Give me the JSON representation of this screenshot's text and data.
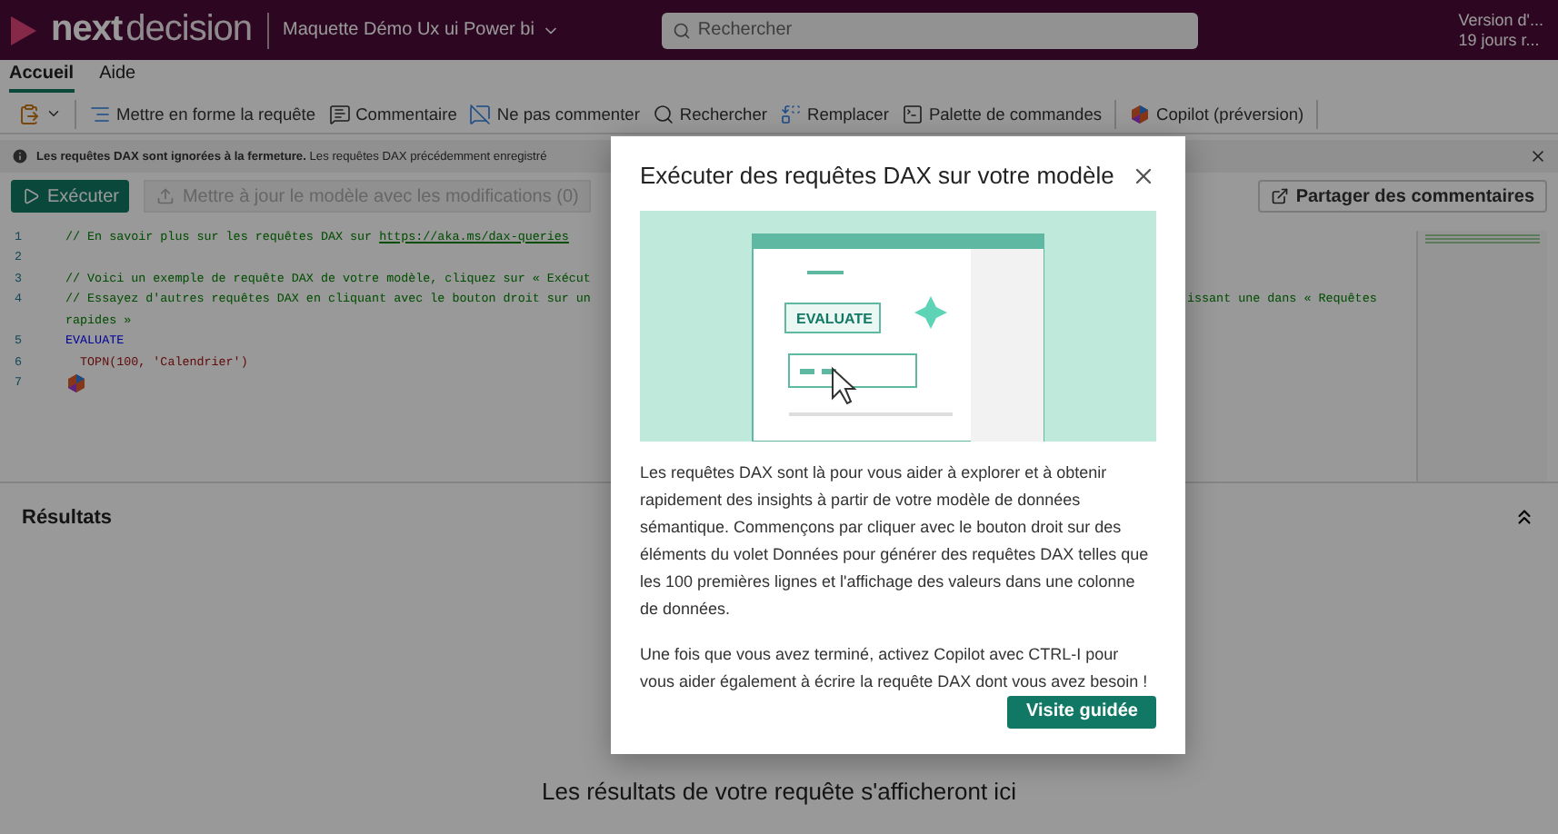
{
  "header": {
    "logo_bold": "next",
    "logo_light": "decision",
    "workspace": "Maquette Démo Ux ui Power bi",
    "search": {
      "placeholder": "Rechercher"
    },
    "version_lines": [
      "Version d'...",
      "19 jours r..."
    ]
  },
  "tabs": [
    {
      "label": "Accueil",
      "selected": true
    },
    {
      "label": "Aide",
      "selected": false
    }
  ],
  "toolbar": [
    {
      "kind": "paste"
    },
    {
      "kind": "format",
      "label": "Mettre en forme la requête"
    },
    {
      "kind": "comment",
      "label": "Commentaire"
    },
    {
      "kind": "uncomment",
      "label": "Ne pas commenter"
    },
    {
      "kind": "search",
      "label": "Rechercher"
    },
    {
      "kind": "replace",
      "label": "Remplacer"
    },
    {
      "kind": "palette",
      "label": "Palette de commandes"
    },
    {
      "kind": "copilot",
      "label": "Copilot (préversion)"
    }
  ],
  "info_bar": {
    "bold": "Les requêtes DAX sont ignorées à la fermeture.",
    "text": "Les requêtes DAX précédemment enregistré"
  },
  "run_bar": {
    "run": "Exécuter",
    "update": {
      "label": "Mettre à jour le modèle avec les modifications (0)",
      "disabled": true
    },
    "share": "Partager des commentaires"
  },
  "editor_lines": [
    {
      "number": "1",
      "kind": "comment",
      "text": "// En savoir plus sur les requêtes DAX sur ",
      "link": "https://aka.ms/dax-queries"
    },
    {
      "number": "2",
      "kind": "blank"
    },
    {
      "number": "3",
      "kind": "comment",
      "text": "// Voici un exemple de requête DAX de votre modèle, cliquez sur « Exécut"
    },
    {
      "number": "4",
      "kind": "comment",
      "text": "// Essayez d'autres requêtes DAX en cliquant avec le bouton droit sur un",
      "text_right": "issant une dans « Requêtes"
    },
    {
      "kind": "comment",
      "text": "rapides »"
    },
    {
      "number": "5",
      "kind": "keyword",
      "text": "EVALUATE"
    },
    {
      "number": "6",
      "kind": "code",
      "text": "TOPN(100, 'Calendrier')"
    },
    {
      "number": "7",
      "kind": "copilot"
    }
  ],
  "results": {
    "title": "Résultats",
    "empty_message": "Les résultats de votre requête s'afficheront ici"
  },
  "dialog": {
    "title": "Exécuter des requêtes DAX sur votre modèle",
    "illustration_label": "EVALUATE",
    "paragraphs": [
      "Les requêtes DAX sont là pour vous aider à explorer et à obtenir rapidement des insights à partir de votre modèle de données sémantique. Commençons par cliquer avec le bouton droit sur des éléments du volet Données pour générer des requêtes DAX telles que les 100 premières lignes et l'affichage des valeurs dans une colonne de données.",
      "Une fois que vous avez terminé, activez Copilot avec CTRL-I pour vous aider également à écrire la requête DAX dont vous avez besoin !"
    ],
    "button": "Visite guidée"
  }
}
